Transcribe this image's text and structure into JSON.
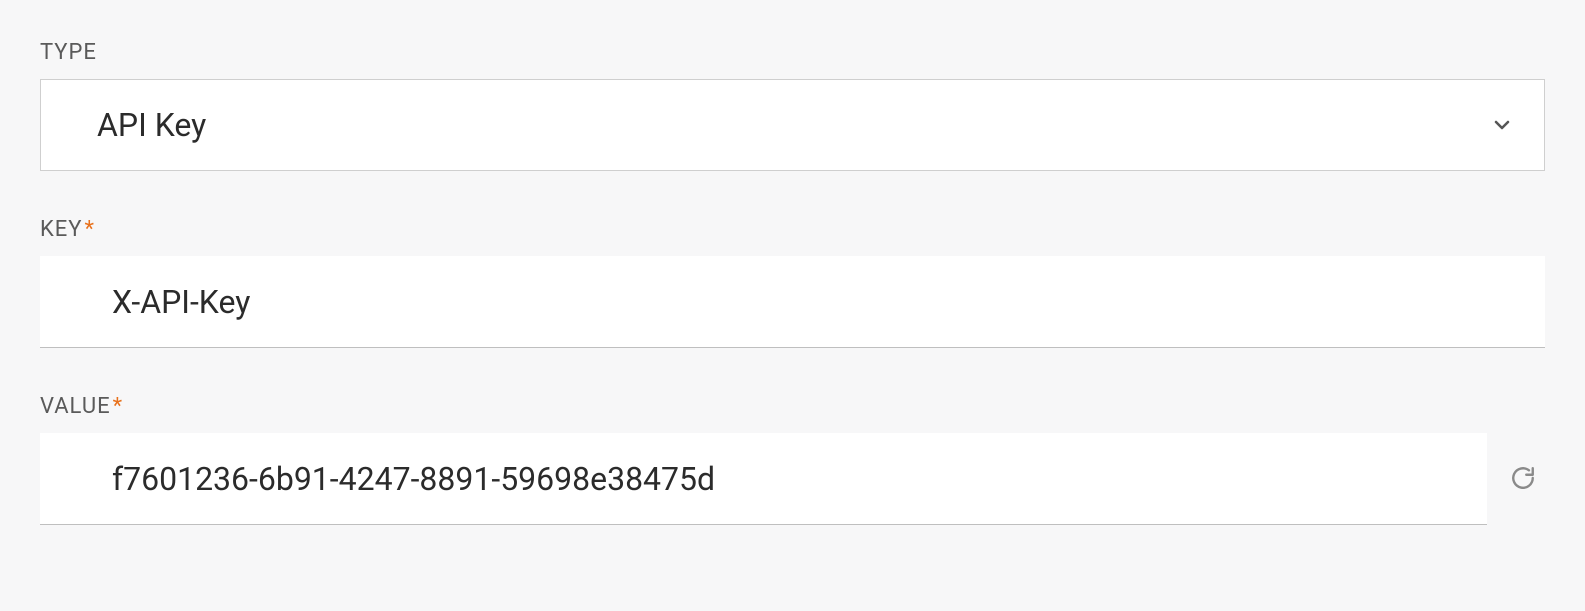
{
  "fields": {
    "type": {
      "label": "TYPE",
      "required": false,
      "selected": "API Key"
    },
    "key": {
      "label": "KEY",
      "required": true,
      "value": "X-API-Key"
    },
    "value": {
      "label": "VALUE",
      "required": true,
      "value": "f7601236-6b91-4247-8891-59698e38475d"
    }
  },
  "required_marker": "*"
}
